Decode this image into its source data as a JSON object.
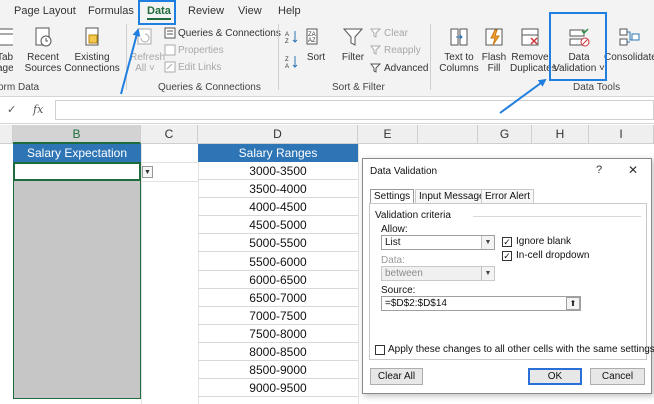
{
  "ribbon": {
    "tabs": [
      {
        "label": "Page Layout",
        "active": false
      },
      {
        "label": "Formulas",
        "active": false
      },
      {
        "label": "Data",
        "active": true
      },
      {
        "label": "Review",
        "active": false
      },
      {
        "label": "View",
        "active": false
      },
      {
        "label": "Help",
        "active": false
      }
    ],
    "get_data": {
      "partial_1": "Table/",
      "partial_2": "age",
      "recent_1": "Recent",
      "recent_2": "Sources",
      "existing_1": "Existing",
      "existing_2": "Connections",
      "group": "orm Data"
    },
    "queries": {
      "refresh_1": "Refresh",
      "refresh_2": "All ˅",
      "connections": "Queries & Connections",
      "properties": "Properties",
      "edit_links": "Edit Links",
      "group": "Queries & Connections"
    },
    "sort_filter": {
      "sort": "Sort",
      "filter": "Filter",
      "clear": "Clear",
      "reapply": "Reapply",
      "advanced": "Advanced",
      "group": "Sort & Filter"
    },
    "data_tools": {
      "text_cols_1": "Text to",
      "text_cols_2": "Columns",
      "flash_1": "Flash",
      "flash_2": "Fill",
      "remove_1": "Remove",
      "remove_2": "Duplicates",
      "validation_1": "Data",
      "validation_2": "Validation ˅",
      "consolidate": "Consolidate",
      "group": "Data Tools"
    }
  },
  "formula_bar": {
    "fx": "fx",
    "value": ""
  },
  "sheet": {
    "columns": [
      "B",
      "C",
      "D",
      "E",
      "G",
      "H",
      "I"
    ],
    "header_b": "Salary Expectation",
    "header_d": "Salary Ranges",
    "ranges": [
      "3000-3500",
      "3500-4000",
      "4000-4500",
      "4500-5000",
      "5000-5500",
      "5500-6000",
      "6000-6500",
      "6500-7000",
      "7000-7500",
      "7500-8000",
      "8000-8500",
      "8500-9000",
      "9000-9500"
    ]
  },
  "dialog": {
    "title": "Data Validation",
    "help": "?",
    "close": "✕",
    "tabs": [
      "Settings",
      "Input Message",
      "Error Alert"
    ],
    "criteria_label": "Validation criteria",
    "allow_label": "Allow:",
    "allow_value": "List",
    "ignore_blank": "Ignore blank",
    "in_cell_dropdown": "In-cell dropdown",
    "data_label": "Data:",
    "data_value": "between",
    "source_label": "Source:",
    "source_value": "=$D$2:$D$14",
    "apply_all": "Apply these changes to all other cells with the same settings",
    "clear_all": "Clear All",
    "ok": "OK",
    "cancel": "Cancel"
  },
  "colors": {
    "excel_green": "#1e6c3c",
    "header_blue": "#2e75b6",
    "highlight_blue": "#1f7fe0"
  }
}
